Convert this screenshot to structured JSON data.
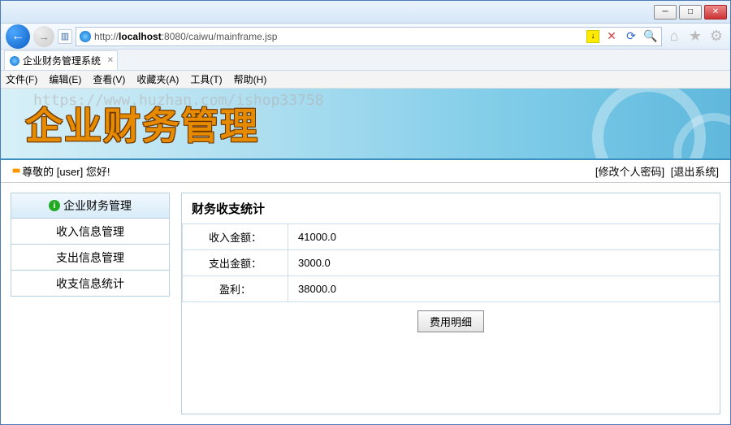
{
  "url_prefix": "http://",
  "url_host": "localhost",
  "url_rest": ":8080/caiwu/mainframe.jsp",
  "tab_title": "企业财务管理系统",
  "watermark": "https://www.huzhan.com/ishop33758",
  "menu": {
    "file": "文件(F)",
    "edit": "编辑(E)",
    "view": "查看(V)",
    "fav": "收藏夹(A)",
    "tools": "工具(T)",
    "help": "帮助(H)"
  },
  "banner_title": "企业财务管理",
  "greeting_prefix": "尊敬的 [",
  "user": "user",
  "greeting_suffix": "] 您好!",
  "link_pwd": "[修改个人密码]",
  "link_exit": "[退出系统]",
  "side": {
    "i0": "企业财务管理",
    "i1": "收入信息管理",
    "i2": "支出信息管理",
    "i3": "收支信息统计"
  },
  "main_title": "财务收支统计",
  "rows": {
    "income_label": "收入金额：",
    "income_val": "41000.0",
    "expense_label": "支出金额：",
    "expense_val": "3000.0",
    "profit_label": "盈利：",
    "profit_val": "38000.0"
  },
  "detail_btn": "费用明细"
}
